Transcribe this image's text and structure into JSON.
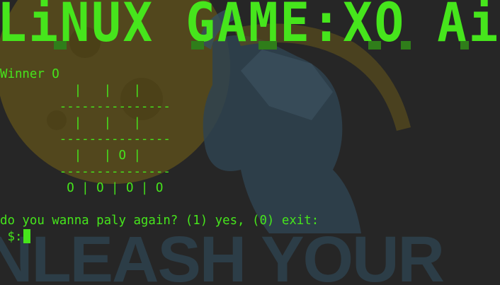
{
  "terminal": {
    "banner": "LiNUX GAME:XO Ai",
    "status": "Winner O",
    "board_lines": [
      "          |   |   |",
      "        ---------------",
      "          |   |   |",
      "        ---------------",
      "          |   | O |",
      "        ---------------",
      "         O | O | O | O"
    ],
    "question": "do you wanna paly again? (1) yes, (0) exit:",
    "prompt": " $:",
    "wallpaper_text": "NLEASH YOUR"
  },
  "colors": {
    "terminal_text": "#46e51c",
    "background": "#262626",
    "wallpaper_gold": "#6b5a1e",
    "wallpaper_blue": "#2e4552"
  }
}
